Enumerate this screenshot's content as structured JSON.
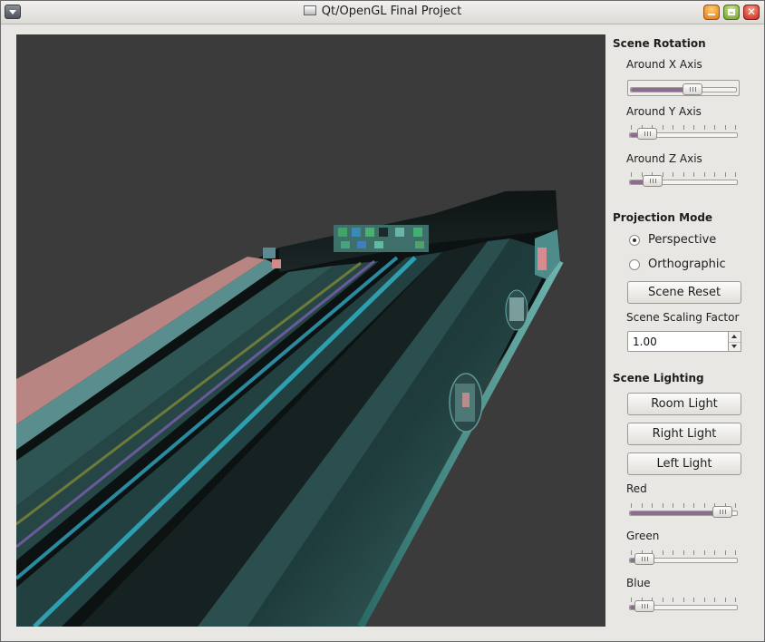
{
  "window": {
    "title": "Qt/OpenGL Final Project"
  },
  "icons": {
    "window_menu": "chevron-down-icon",
    "title": "window-icon",
    "minimize": "minimize-icon",
    "maximize": "maximize-icon",
    "close": "close-icon"
  },
  "scene_rotation": {
    "title": "Scene Rotation",
    "x_label": "Around X Axis",
    "x_value": 0.6,
    "y_label": "Around Y Axis",
    "y_value": 0.09,
    "z_label": "Around Z Axis",
    "z_value": 0.15
  },
  "projection": {
    "title": "Projection Mode",
    "perspective_label": "Perspective",
    "orthographic_label": "Orthographic",
    "selected": "Perspective",
    "reset_label": "Scene Reset",
    "scaling_label": "Scene Scaling Factor",
    "scaling_value": "1.00"
  },
  "lighting": {
    "title": "Scene Lighting",
    "room_label": "Room Light",
    "right_label": "Right Light",
    "left_label": "Left Light",
    "red_label": "Red",
    "red_value": 0.94,
    "green_label": "Green",
    "green_value": 0.06,
    "blue_label": "Blue",
    "blue_value": 0.06
  },
  "colors": {
    "viewport_bg": "#3b3b3b",
    "slider_fill": "#8c6b8e",
    "panel_bg": "#e8e7e3"
  }
}
